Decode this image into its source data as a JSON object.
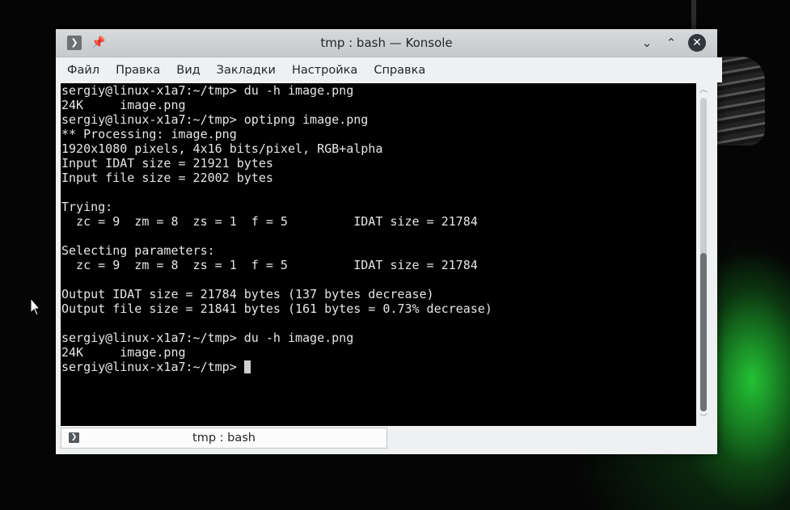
{
  "window": {
    "title": "tmp : bash — Konsole",
    "controls": {
      "minimize": "⌄",
      "maximize": "⌃",
      "close": "✕"
    }
  },
  "menubar": {
    "items": [
      "Файл",
      "Правка",
      "Вид",
      "Закладки",
      "Настройка",
      "Справка"
    ]
  },
  "terminal": {
    "lines": [
      "sergiy@linux-x1a7:~/tmp> du -h image.png",
      "24K     image.png",
      "sergiy@linux-x1a7:~/tmp> optipng image.png",
      "** Processing: image.png",
      "1920x1080 pixels, 4x16 bits/pixel, RGB+alpha",
      "Input IDAT size = 21921 bytes",
      "Input file size = 22002 bytes",
      "",
      "Trying:",
      "  zc = 9  zm = 8  zs = 1  f = 5         IDAT size = 21784",
      "",
      "Selecting parameters:",
      "  zc = 9  zm = 8  zs = 1  f = 5         IDAT size = 21784",
      "",
      "Output IDAT size = 21784 bytes (137 bytes decrease)",
      "Output file size = 21841 bytes (161 bytes = 0.73% decrease)",
      "",
      "sergiy@linux-x1a7:~/tmp> du -h image.png",
      "24K     image.png"
    ],
    "prompt": "sergiy@linux-x1a7:~/tmp> "
  },
  "tabs": [
    {
      "label": "tmp : bash"
    }
  ],
  "colors": {
    "terminal_bg": "#000000",
    "terminal_fg": "#e6e6e6",
    "accent_green": "#28dc3c"
  }
}
